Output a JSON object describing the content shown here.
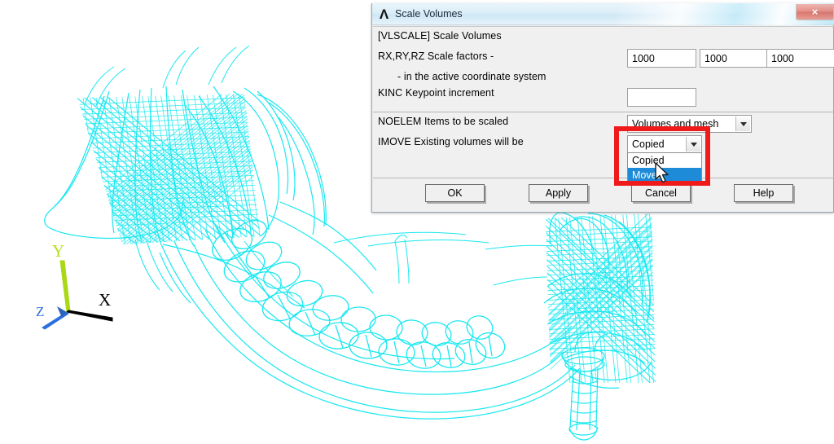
{
  "viewport": {
    "model_name": "mandible-wireframe-model",
    "model_color": "#19e8f0",
    "background_color": "#ffffff",
    "axes": {
      "x_label": "X",
      "y_label": "Y",
      "z_label": "Z",
      "x_color": "#000000",
      "y_color": "#b7e020",
      "z_color": "#2b6fe0"
    }
  },
  "dialog": {
    "title": "Scale Volumes",
    "title_icon": "ansys-lambda-icon",
    "close_label": "×",
    "header_label": "[VLSCALE]  Scale Volumes",
    "rows": {
      "scale_factors_label": "RX,RY,RZ  Scale factors -",
      "coord_note_label": "- in the active coordinate system",
      "kinc_label": "KINC   Keypoint increment",
      "noelem_label": "NOELEM  Items to be scaled",
      "imove_label": "IMOVE  Existing volumes will be"
    },
    "fields": {
      "rx_value": "1000",
      "ry_value": "1000",
      "rz_value": "1000",
      "kinc_value": "",
      "kinc_placeholder": ""
    },
    "combo_noelem": {
      "selected": "Volumes and mesh",
      "options": [
        "Volumes and mesh"
      ]
    },
    "combo_imove": {
      "selected": "Copied",
      "options": [
        "Copied",
        "Moved"
      ],
      "highlighted": "Moved",
      "highlight_color": "#1e8bd8",
      "expanded": true
    },
    "buttons": {
      "ok": "OK",
      "apply": "Apply",
      "cancel": "Cancel",
      "help": "Help"
    }
  },
  "annotation": {
    "rect_color": "#ef1b1b",
    "rect_name": "imove-dropdown-highlight"
  }
}
